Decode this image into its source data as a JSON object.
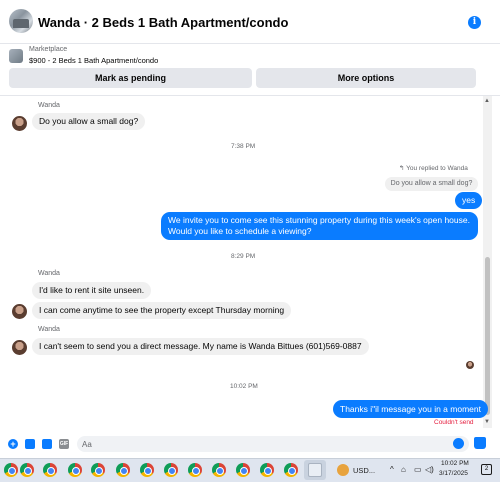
{
  "header": {
    "title": "Wanda · 2 Beds 1 Bath Apartment/condo",
    "info_icon": "info-icon"
  },
  "listing": {
    "label": "Marketplace",
    "price_title": "$900 - 2 Beds 1 Bath Apartment/condo",
    "mark_pending": "Mark as pending",
    "more_options": "More options"
  },
  "messages": {
    "sender1": "Wanda",
    "msg1": "Do you allow a small dog?",
    "time1": "7:38 PM",
    "replied_to": "You replied to Wanda",
    "quoted": "Do you allow a small dog?",
    "reply_yes": "yes",
    "openhouse_line1": "We invite you to come see this stunning property during this week's open house.",
    "openhouse_line2": "Would you like to schedule a viewing?",
    "time2": "8:29 PM",
    "sender2": "Wanda",
    "msg2": "I'd like to rent it site unseen.",
    "msg3": "I can come anytime to see the property except Thursday morning",
    "sender3": "Wanda",
    "msg4": "I can't seem to send you a direct message. My name is Wanda Bittues (601)569-0887",
    "time3": "10:02 PM",
    "reply_thanks": "Thanks i\"il message you in a moment",
    "error": "Couldn't send"
  },
  "composer": {
    "placeholder": "Aa"
  },
  "taskbar": {
    "currency": "USD...",
    "time": "10:02 PM",
    "date": "3/17/2025",
    "notifications": "2"
  },
  "colors": {
    "accent": "#0a7cff",
    "bubble_in": "#f0f0f0",
    "error": "#e41e3f"
  }
}
